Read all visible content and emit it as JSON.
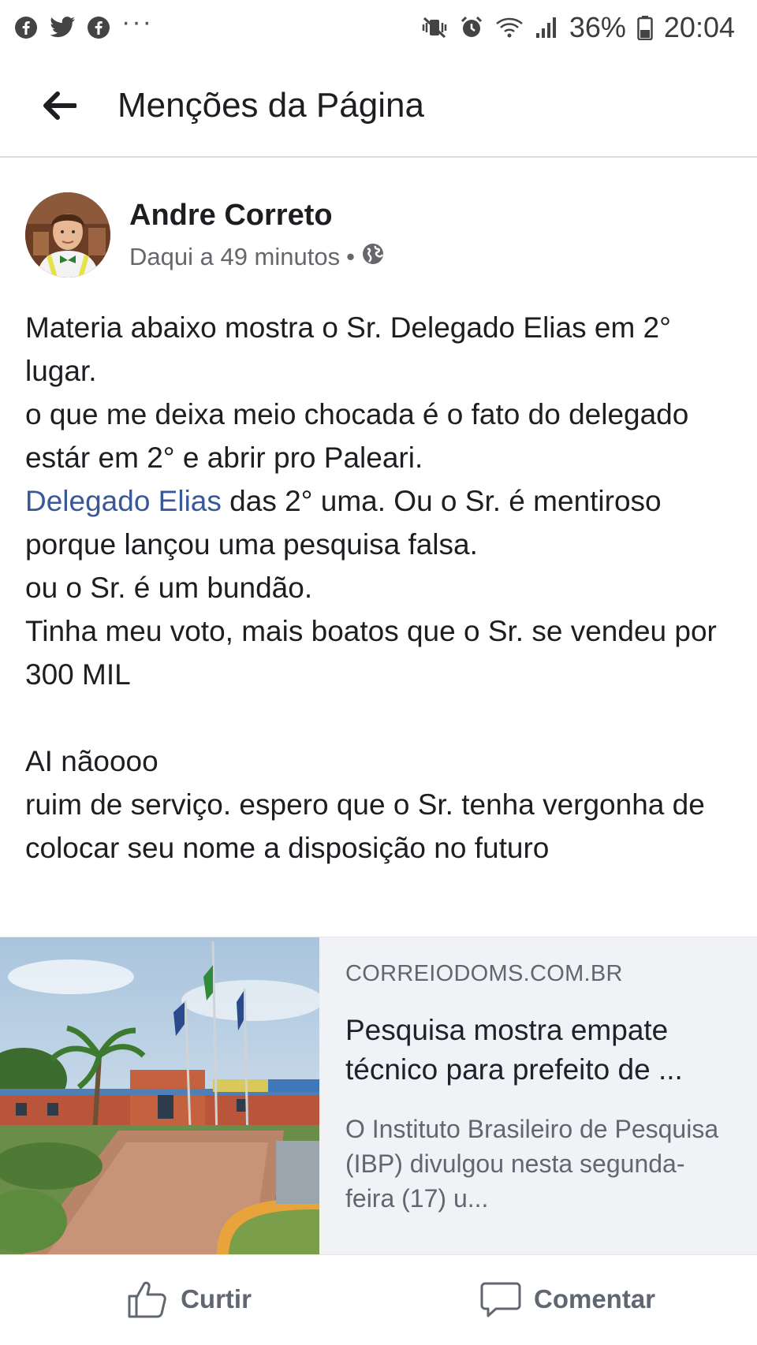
{
  "status_bar": {
    "left_icons": [
      "facebook-icon",
      "twitter-icon",
      "messenger-icon"
    ],
    "overflow_dots": "···",
    "battery_percent": "36%",
    "time": "20:04"
  },
  "header": {
    "title": "Menções da Página"
  },
  "post": {
    "author": "Andre Correto",
    "timestamp": "Daqui a 49 minutos",
    "separator": "•",
    "privacy_icon": "globe-icon",
    "body": {
      "p1": "Materia abaixo mostra o Sr. Delegado Elias em 2° lugar.",
      "p2": "o que me deixa meio chocada é o fato do delegado estár em 2° e abrir pro Paleari.",
      "mention": "Delegado Elias",
      "p3_rest": " das 2° uma. Ou o Sr. é mentiroso porque lançou uma pesquisa falsa.",
      "p4": "ou o Sr. é um bundão.",
      "p5": "Tinha meu voto, mais boatos que o Sr. se vendeu por 300 MIL",
      "p6": "AI nãoooo",
      "p7": "ruim de serviço. espero que o Sr. tenha vergonha de colocar seu nome a disposição no futuro"
    }
  },
  "link_card": {
    "domain": "CORREIODOMS.COM.BR",
    "headline": "Pesquisa mostra empate técnico para prefeito de ...",
    "description": "O Instituto Brasileiro de Pesquisa (IBP) divulgou nesta segunda-feira (17) u..."
  },
  "actions": {
    "like_label": "Curtir",
    "comment_label": "Comentar"
  },
  "colors": {
    "link_blue": "#385898",
    "card_bg": "#f0f2f5"
  }
}
